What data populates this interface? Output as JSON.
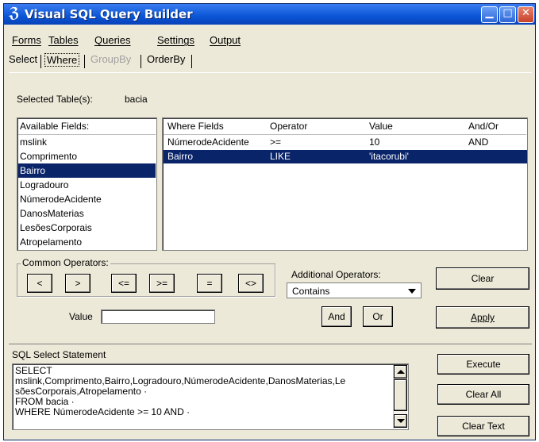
{
  "window": {
    "title": "Visual SQL Query Builder",
    "icon": "sql-logo-icon",
    "controls": {
      "minimize": "minimize-icon",
      "maximize": "maximize-icon",
      "close": "close-icon"
    }
  },
  "menu": {
    "items": [
      "Forms",
      "Tables",
      "Queries",
      "Settings",
      "Output"
    ]
  },
  "tabs": {
    "items": [
      {
        "label": "Select",
        "state": "normal"
      },
      {
        "label": "Where",
        "state": "active"
      },
      {
        "label": "GroupBy",
        "state": "disabled"
      },
      {
        "label": "OrderBy",
        "state": "normal"
      }
    ]
  },
  "selected_tables": {
    "label": "Selected Table(s):",
    "value": "bacia"
  },
  "available_fields": {
    "header": "Available Fields:",
    "items": [
      "mslink",
      "Comprimento",
      "Bairro",
      "Logradouro",
      "NúmerodeAcidente",
      "DanosMaterias",
      "LesõesCorporais",
      "Atropelamento"
    ],
    "selected": "Bairro"
  },
  "where_table": {
    "headers": [
      "Where Fields",
      "Operator",
      "Value",
      "And/Or"
    ],
    "rows": [
      [
        "NúmerodeAcidente",
        ">=",
        "10",
        "AND"
      ],
      [
        "Bairro",
        "LIKE",
        "'itacorubi'",
        ""
      ]
    ],
    "selected_row": 1
  },
  "common_operators": {
    "title": "Common Operators:",
    "buttons": [
      "<",
      ">",
      "<=",
      ">=",
      "=",
      "<>"
    ]
  },
  "additional_operators": {
    "label": "Additional Operators:",
    "selected": "Contains"
  },
  "value_field": {
    "label": "Value",
    "value": ""
  },
  "buttons": {
    "clear": "Clear",
    "and": "And",
    "or": "Or",
    "apply": "Apply",
    "execute": "Execute",
    "clear_all": "Clear All",
    "clear_text": "Clear Text"
  },
  "sql_statement": {
    "title": "SQL Select Statement",
    "lines": [
      "SELECT",
      "mslink,Comprimento,Bairro,Logradouro,NúmerodeAcidente,DanosMaterias,Le",
      "sõesCorporais,Atropelamento ·",
      "FROM  bacia ·",
      "WHERE NúmerodeAcidente >= 10 AND ·"
    ]
  },
  "colors": {
    "titlebar": "#0a55d6",
    "selection": "#0a246a",
    "face": "#ece9d8"
  }
}
